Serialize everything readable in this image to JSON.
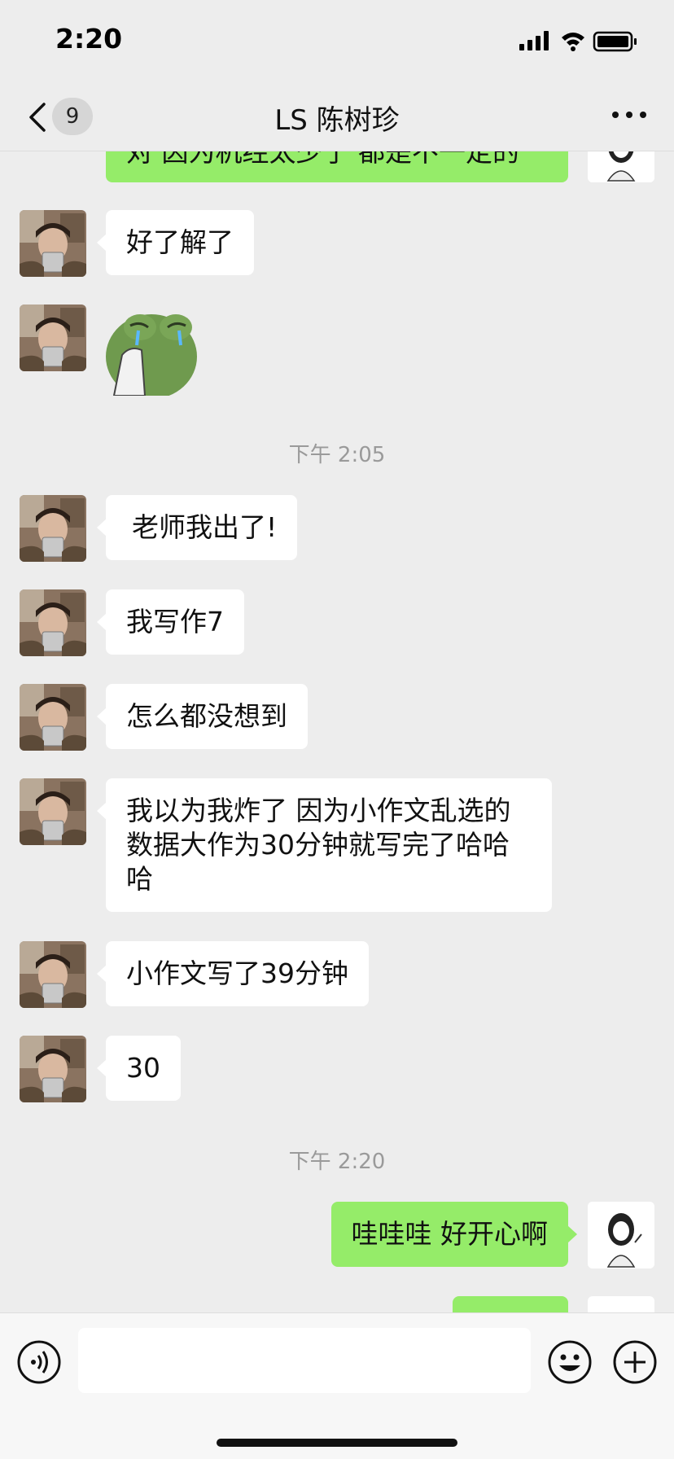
{
  "status_bar": {
    "time": "2:20"
  },
  "nav": {
    "unread_count": "9",
    "title": "LS 陈树珍"
  },
  "messages": {
    "partial_top": "对  因为机经太少了  都是不一定的",
    "m1": "好了解了",
    "m2": "老师我出了!",
    "m3": "我写作7",
    "m4": "怎么都没想到",
    "m5": [
      "我以为我炸了 因为小作文乱选的",
      "数据大作为30分钟就写完了哈哈",
      "哈"
    ],
    "m6": "小作文写了39分钟",
    "m7": "30",
    "m8": "哇哇哇  好开心啊"
  },
  "timestamps": {
    "t1": "下午 2:05",
    "t2": "下午 2:20"
  },
  "sticker": {
    "name": "crying-frog-sticker"
  },
  "colors": {
    "background": "#ededed",
    "incoming_bubble": "#ffffff",
    "outgoing_bubble": "#95ec69",
    "timestamp_text": "#9a9a9a"
  },
  "icons": {
    "back": "chevron-left-icon",
    "more": "more-dots-icon",
    "voice": "voice-icon",
    "emoji": "emoji-icon",
    "add": "add-icon"
  }
}
